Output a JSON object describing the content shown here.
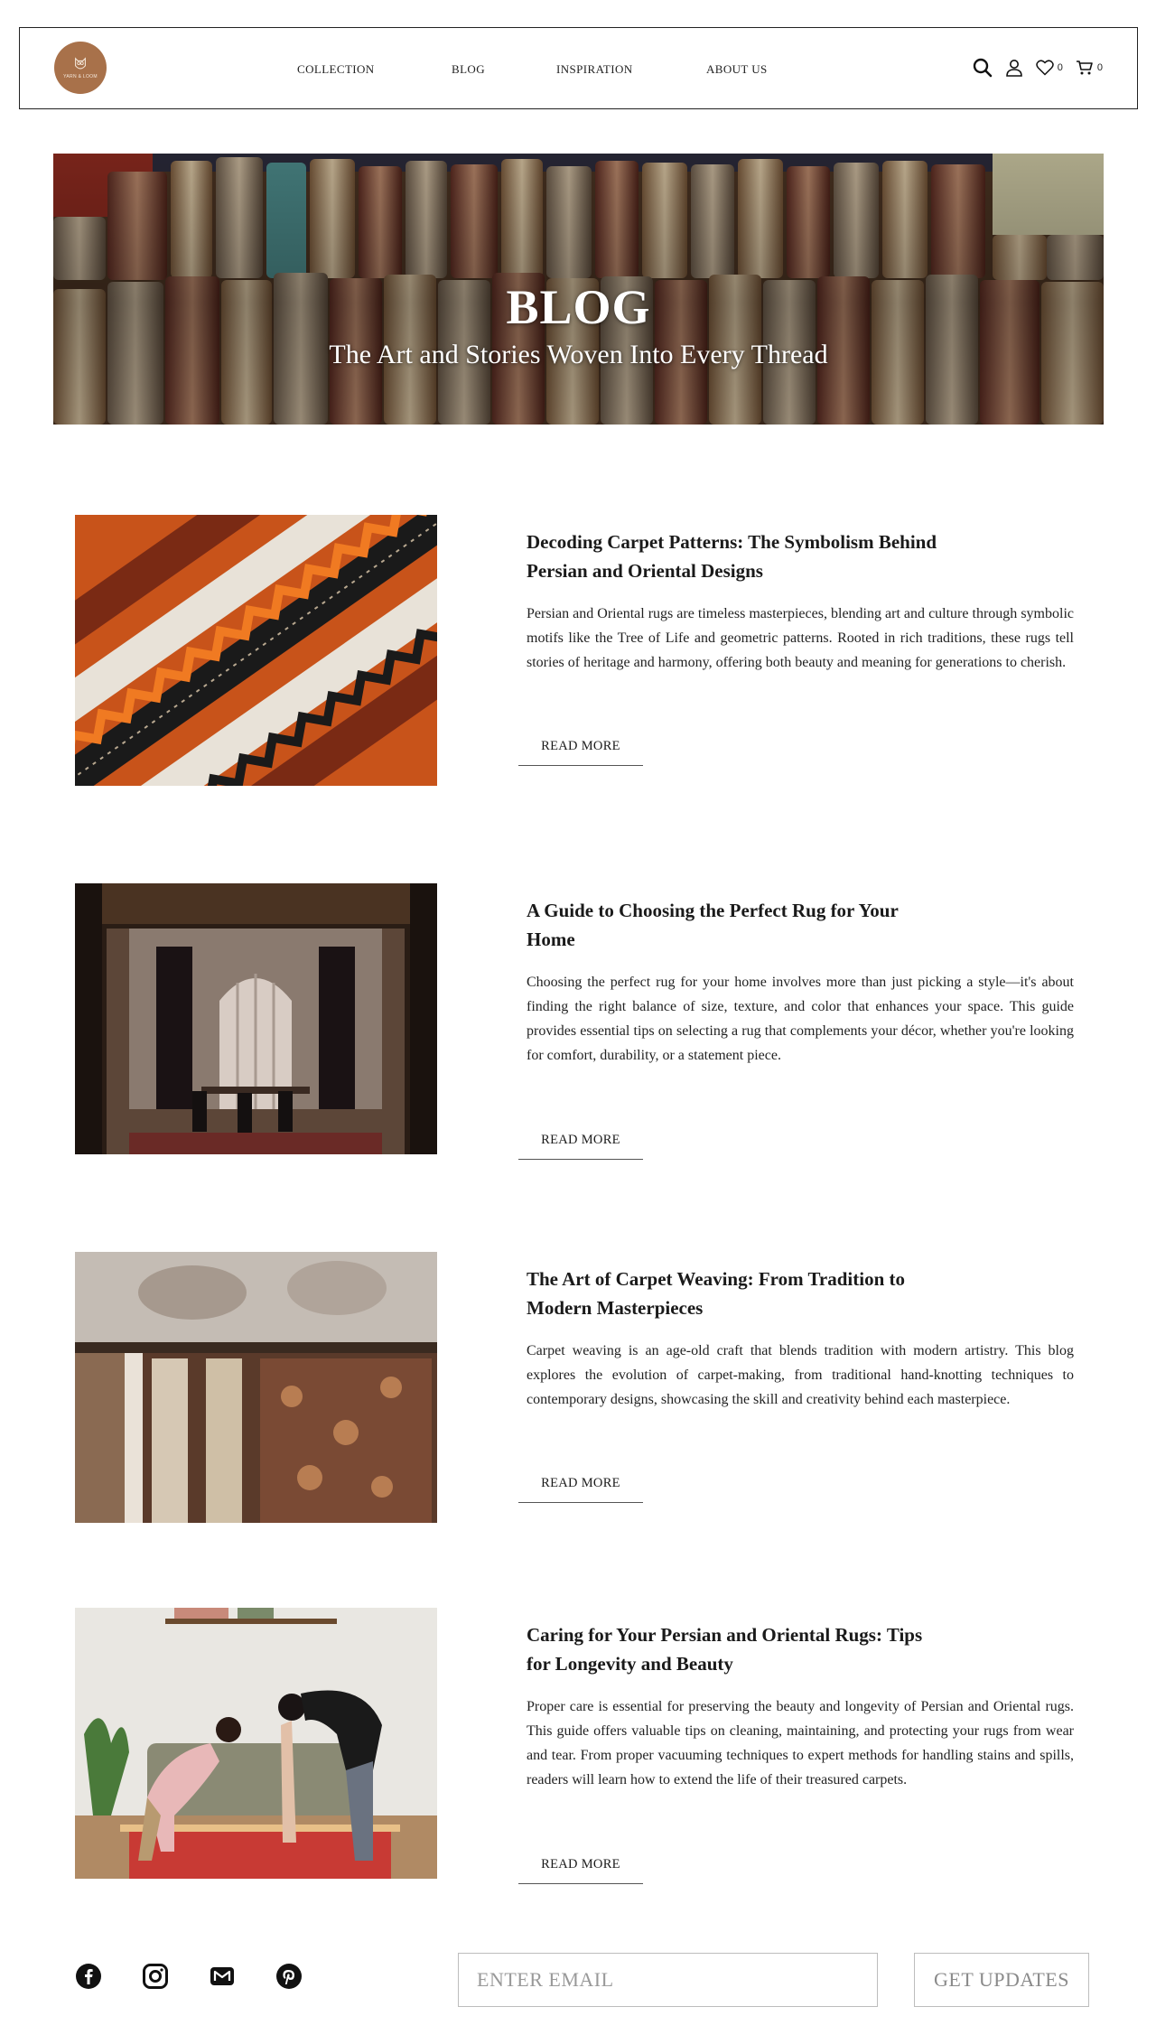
{
  "header": {
    "logo_text": "YARN & LOOM",
    "nav": [
      "COLLECTION",
      "BLOG",
      "INSPIRATION",
      "ABOUT US"
    ],
    "wishlist_count": "0",
    "cart_count": "0"
  },
  "hero": {
    "title": "BLOG",
    "subtitle": "The Art and Stories Woven Into Every Thread"
  },
  "posts": [
    {
      "title": "Decoding Carpet Patterns: The Symbolism Behind Persian and Oriental Designs",
      "excerpt": "Persian and Oriental rugs are timeless masterpieces, blending art and culture through symbolic motifs like the Tree of Life and geometric patterns. Rooted in rich traditions, these rugs tell stories of heritage and harmony, offering both beauty and meaning for generations to cherish.",
      "cta": "READ MORE"
    },
    {
      "title": "A Guide to Choosing the Perfect Rug for Your Home",
      "excerpt": "Choosing the perfect rug for your home involves more than just picking a style—it's about finding the right balance of size, texture, and color that enhances your space. This guide provides essential tips on selecting a rug that complements your décor, whether you're looking for comfort, durability, or a statement piece.",
      "cta": "READ MORE"
    },
    {
      "title": "The Art of Carpet Weaving: From Tradition to Modern Masterpieces",
      "excerpt": "Carpet weaving is an age-old craft that blends tradition with modern artistry. This blog explores the evolution of carpet-making, from traditional hand-knotting techniques to contemporary designs, showcasing the skill and creativity behind each masterpiece.",
      "cta": "READ MORE"
    },
    {
      "title": "Caring for Your Persian and Oriental Rugs: Tips for Longevity and Beauty",
      "excerpt": "Proper care is essential for preserving the beauty and longevity of Persian and Oriental rugs. This guide offers valuable tips on cleaning, maintaining, and protecting your rugs from wear and tear. From proper vacuuming techniques to expert methods for handling stains and spills, readers will learn how to extend the life of their treasured carpets.",
      "cta": "READ MORE"
    }
  ],
  "footer": {
    "social_icons": [
      "facebook-icon",
      "instagram-icon",
      "mail-icon",
      "pinterest-icon"
    ],
    "email_placeholder": "ENTER EMAIL",
    "button_label": "GET UPDATES"
  },
  "colors": {
    "logo_bg": "#a8714a",
    "border": "#222222",
    "input_border": "#bdbdbd"
  }
}
